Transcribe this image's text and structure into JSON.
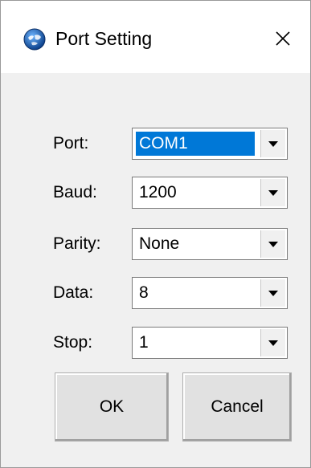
{
  "window": {
    "title": "Port Setting",
    "close_glyph": "✕"
  },
  "fields": [
    {
      "label": "Port:",
      "value": "COM1",
      "selected": true
    },
    {
      "label": "Baud:",
      "value": "1200"
    },
    {
      "label": "Parity:",
      "value": "None"
    },
    {
      "label": "Data:",
      "value": "8"
    },
    {
      "label": "Stop:",
      "value": "1"
    }
  ],
  "buttons": {
    "ok_label": "OK",
    "cancel_label": "Cancel"
  },
  "colors": {
    "selection_highlight": "#0078d7",
    "dialog_background": "#f0f0f0"
  },
  "icons": {
    "app": "app-globe-icon",
    "close": "close-icon",
    "dropdown": "chevron-down-icon"
  }
}
